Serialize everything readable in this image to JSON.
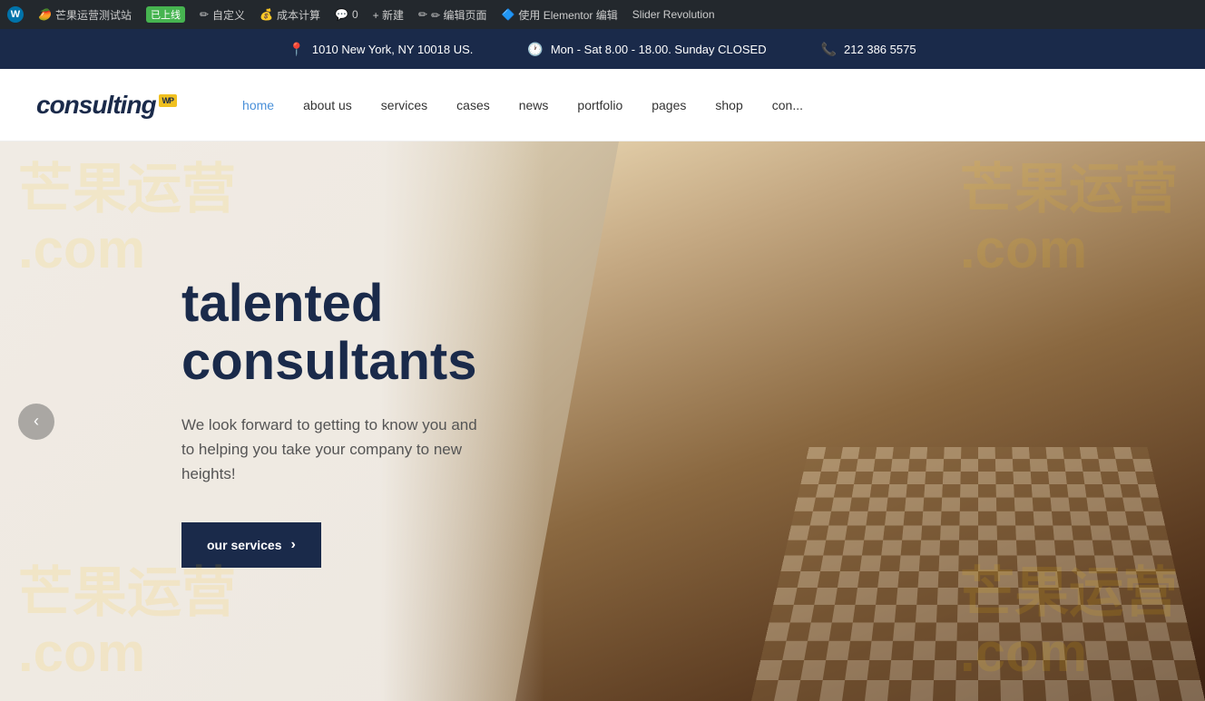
{
  "adminBar": {
    "items": [
      {
        "id": "wp-logo",
        "label": "",
        "icon": "W"
      },
      {
        "id": "site-name",
        "label": "芒果运营测试站"
      },
      {
        "id": "status",
        "label": "已上线"
      },
      {
        "id": "customize",
        "label": "自定义"
      },
      {
        "id": "cost",
        "label": "成本计算"
      },
      {
        "id": "comments",
        "icon": "💬",
        "label": "0"
      },
      {
        "id": "new",
        "label": "+ 新建"
      },
      {
        "id": "edit-page",
        "label": "✏ 编辑页面"
      },
      {
        "id": "elementor",
        "label": "使用 Elementor 编辑"
      },
      {
        "id": "slider",
        "label": "Slider Revolution"
      }
    ]
  },
  "topBar": {
    "address": {
      "icon": "📍",
      "text": "1010 New York, NY 10018 US."
    },
    "hours": {
      "icon": "🕐",
      "text": "Mon - Sat 8.00 - 18.00. Sunday CLOSED"
    },
    "phone": {
      "icon": "📞",
      "text": "212 386 5575"
    }
  },
  "header": {
    "logo": {
      "text": "consulting",
      "badge": "WP"
    },
    "nav": [
      {
        "id": "home",
        "label": "home",
        "active": true
      },
      {
        "id": "about",
        "label": "about us",
        "active": false
      },
      {
        "id": "services",
        "label": "services",
        "active": false
      },
      {
        "id": "cases",
        "label": "cases",
        "active": false
      },
      {
        "id": "news",
        "label": "news",
        "active": false
      },
      {
        "id": "portfolio",
        "label": "portfolio",
        "active": false
      },
      {
        "id": "pages",
        "label": "pages",
        "active": false
      },
      {
        "id": "shop",
        "label": "shop",
        "active": false
      },
      {
        "id": "contact",
        "label": "con...",
        "active": false
      }
    ]
  },
  "hero": {
    "title": "talented consultants",
    "subtitle": "We look forward to getting to know you and to helping you take your company to new heights!",
    "buttonLabel": "our services",
    "buttonArrow": "›",
    "prevArrow": "‹",
    "watermark": "芒果运营.com"
  }
}
